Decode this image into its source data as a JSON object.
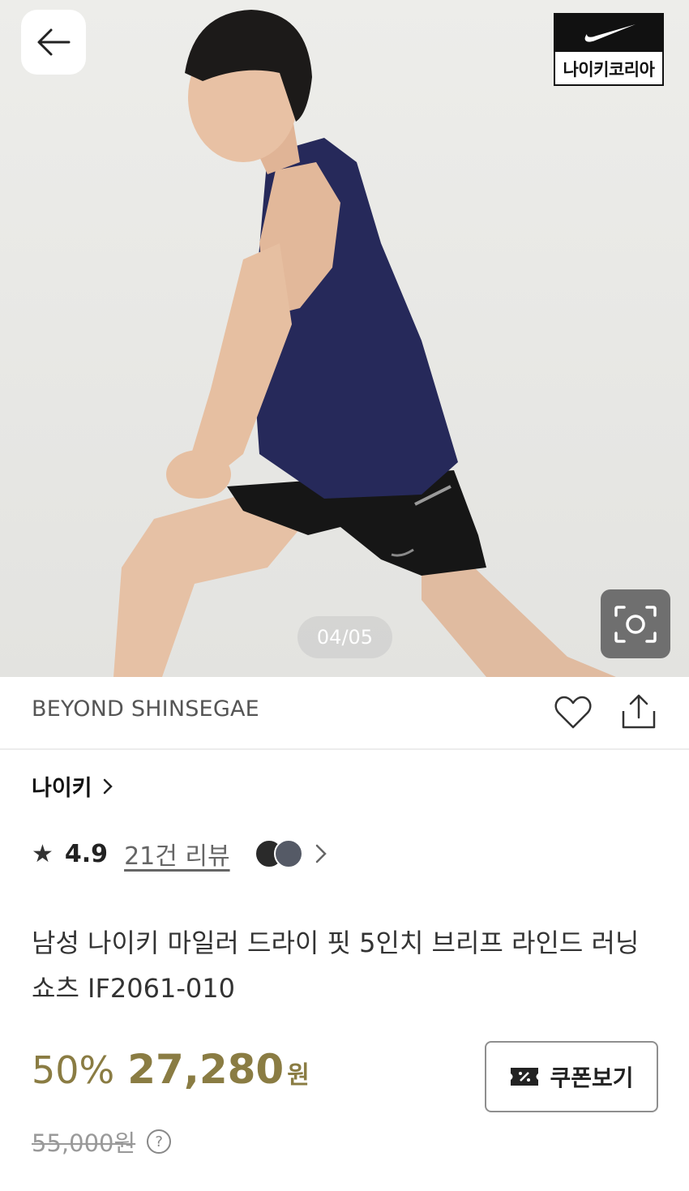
{
  "hero": {
    "image_counter": "04/05",
    "badge_label": "나이키코리아",
    "icons": [
      "back-arrow-icon",
      "nike-swoosh-icon",
      "lens-search-icon"
    ]
  },
  "store": {
    "name": "BEYOND SHINSEGAE",
    "icons": [
      "heart-icon",
      "share-icon"
    ]
  },
  "product": {
    "brand": "나이키",
    "rating": "4.9",
    "review_count": "21건 리뷰",
    "title": "남성 나이키 마일러 드라이 핏 5인치 브리프 라인드 러닝 쇼츠 IF2061-010"
  },
  "price": {
    "discount": "50%",
    "sale_price": "27,280",
    "currency": "원",
    "original_price": "55,000원",
    "coupon_label": "쿠폰보기",
    "help_symbol": "?"
  },
  "colors": {
    "price_accent": "#8a7c43",
    "badge_black": "#111111"
  }
}
